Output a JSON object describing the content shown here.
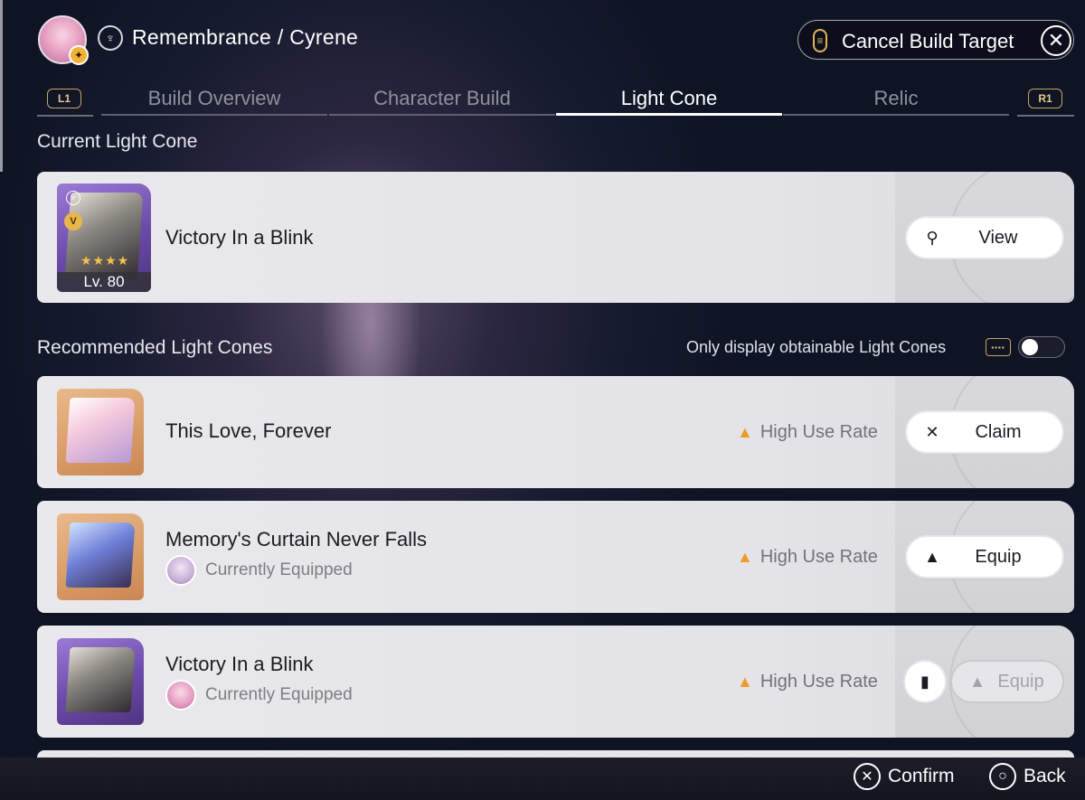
{
  "header": {
    "title": "Remembrance / Cyrene",
    "cancel_label": "Cancel Build Target",
    "avatar_badge_icon": "pin-icon",
    "path_icon": "remembrance-path-icon"
  },
  "tabs": {
    "left_bumper": "L1",
    "right_bumper": "R1",
    "items": [
      {
        "label": "Build Overview",
        "active": false
      },
      {
        "label": "Character Build",
        "active": false
      },
      {
        "label": "Light Cone",
        "active": true
      },
      {
        "label": "Relic",
        "active": false
      }
    ]
  },
  "current": {
    "section_title": "Current Light Cone",
    "name": "Victory In a Blink",
    "level": "Lv. 80",
    "rank": "V",
    "stars": "★★★★",
    "button_label": "View",
    "button_icon": "search-icon"
  },
  "recommended": {
    "section_title": "Recommended Light Cones",
    "filter_label": "Only display obtainable Light Cones",
    "filter_enabled": false,
    "items": [
      {
        "name": "This Love, Forever",
        "use_rate": "High Use Rate",
        "button_label": "Claim",
        "button_icon": "claim-icon",
        "equipped_text": ""
      },
      {
        "name": "Memory's Curtain Never Falls",
        "use_rate": "High Use Rate",
        "button_label": "Equip",
        "button_icon": "equip-icon",
        "equipped_text": "Currently Equipped"
      },
      {
        "name": "Victory In a Blink",
        "use_rate": "High Use Rate",
        "button_label": "Equip",
        "button_icon": "equip-icon",
        "equipped_text": "Currently Equipped",
        "disabled": true
      }
    ]
  },
  "footer": {
    "confirm_label": "Confirm",
    "back_label": "Back"
  },
  "colors": {
    "accent_gold": "#e0b357",
    "use_rate_orange": "#ef9a2a",
    "card_bg": "#e9e9ec"
  }
}
